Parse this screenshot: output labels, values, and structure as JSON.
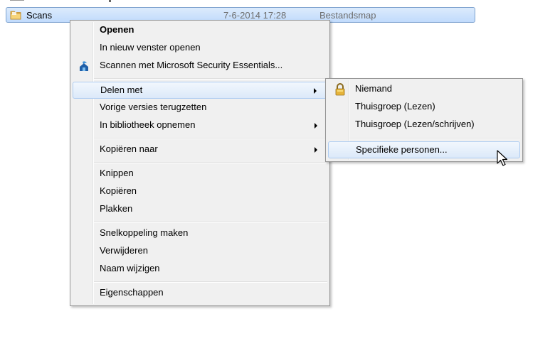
{
  "file": {
    "name": "Scans",
    "date": "7-6-2014 17:28",
    "type": "Bestandsmap"
  },
  "context_menu": {
    "open": "Openen",
    "open_new_window": "In nieuw venster openen",
    "scan_mse": "Scannen met Microsoft Security Essentials...",
    "share_with": "Delen met",
    "restore_previous": "Vorige versies terugzetten",
    "include_library": "In bibliotheek opnemen",
    "copy_to": "Kopiëren naar",
    "cut": "Knippen",
    "copy": "Kopiëren",
    "paste": "Plakken",
    "create_shortcut": "Snelkoppeling maken",
    "delete": "Verwijderen",
    "rename": "Naam wijzigen",
    "properties": "Eigenschappen"
  },
  "share_submenu": {
    "nobody": "Niemand",
    "homegroup_read": "Thuisgroep (Lezen)",
    "homegroup_readwrite": "Thuisgroep (Lezen/schrijven)",
    "specific_people": "Specifieke personen..."
  },
  "icons": {
    "folder": "folder-icon",
    "mse": "microsoft-security-essentials-icon",
    "lock": "lock-icon",
    "cursor": "mouse-cursor-icon"
  },
  "colors": {
    "selection_border": "#7da2ce",
    "selection_fill": "#c1dbfc",
    "menu_background": "#f0f0f0",
    "hover_border": "#aeccf1"
  }
}
